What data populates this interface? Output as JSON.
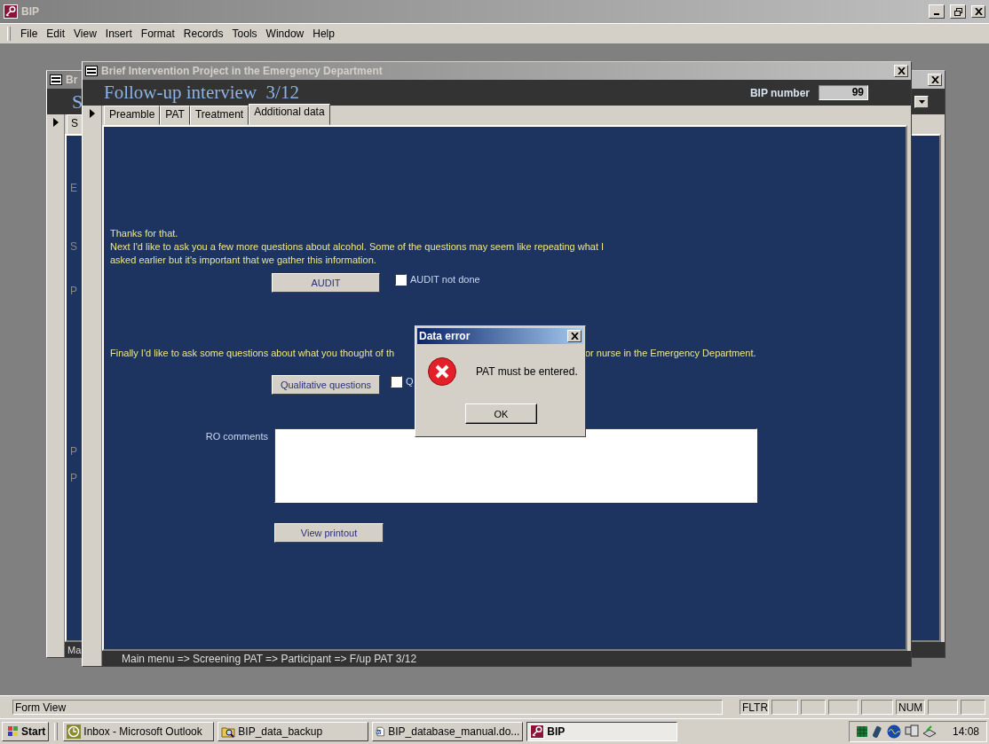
{
  "app": {
    "title": "BIP"
  },
  "menu": [
    "File",
    "Edit",
    "View",
    "Insert",
    "Format",
    "Records",
    "Tools",
    "Window",
    "Help"
  ],
  "back_window": {
    "title": "Br",
    "header": "S",
    "tab": "S",
    "labels": [
      "E",
      "S",
      "P",
      "P",
      "P"
    ],
    "status": "Ma"
  },
  "form": {
    "title": "Brief Intervention Project in the Emergency Department",
    "heading": "Follow-up interview  3/12",
    "bip_label": "BIP number",
    "bip_value": "99",
    "tabs": [
      {
        "label": "Preamble",
        "selected": false
      },
      {
        "label": "PAT",
        "selected": false
      },
      {
        "label": "Treatment",
        "selected": false
      },
      {
        "label": "Additional data",
        "selected": true
      }
    ],
    "intro": [
      "Thanks for that.",
      "Next I'd like to ask you a few more questions about alcohol. Some of the questions may seem like repeating what I",
      "asked earlier but it's important that we gather this information."
    ],
    "audit_button": "AUDIT",
    "audit_check": {
      "label": "AUDIT not done",
      "checked": false
    },
    "finally_left": "Finally I'd like to ask some questions about what you thought of th",
    "finally_right": "or nurse in the Emergency Department.",
    "qual_button": "Qualitative questions",
    "qual_check": {
      "label": "Q",
      "checked": false
    },
    "comments_label": "RO comments",
    "print_button": "View printout",
    "breadcrumb": "Main menu => Screening PAT => Participant => F/up PAT 3/12"
  },
  "dialog": {
    "title": "Data error",
    "message": "PAT must be entered.",
    "button": "OK"
  },
  "status_bar": {
    "mode": "Form View",
    "indicators": [
      "FLTR",
      "NUM"
    ]
  },
  "taskbar": {
    "start": "Start",
    "clock": "14:08",
    "tasks": [
      {
        "label": "Inbox - Microsoft Outlook",
        "kind": "outlook",
        "selected": false
      },
      {
        "label": "BIP_data_backup",
        "kind": "folder",
        "selected": false
      },
      {
        "label": "BIP_database_manual.do...",
        "kind": "document",
        "selected": false
      },
      {
        "label": "BIP",
        "kind": "access",
        "selected": true
      }
    ]
  }
}
